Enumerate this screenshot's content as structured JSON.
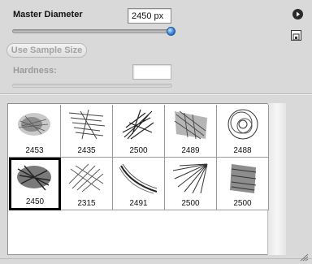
{
  "master_diameter": {
    "label": "Master Diameter",
    "value": "2450 px",
    "slider_fraction": 0.98
  },
  "use_sample_size_label": "Use Sample Size",
  "hardness": {
    "label": "Hardness:",
    "value": ""
  },
  "icons": {
    "flyout": "flyout-menu-icon",
    "new_preset": "new-preset-icon",
    "resize": "resize-grip-icon"
  },
  "brushes": [
    {
      "size": "2453",
      "selected": false
    },
    {
      "size": "2435",
      "selected": false
    },
    {
      "size": "2500",
      "selected": false
    },
    {
      "size": "2489",
      "selected": false
    },
    {
      "size": "2488",
      "selected": false
    },
    {
      "size": "2450",
      "selected": true
    },
    {
      "size": "2315",
      "selected": false
    },
    {
      "size": "2491",
      "selected": false
    },
    {
      "size": "2500",
      "selected": false
    },
    {
      "size": "2500",
      "selected": false
    }
  ]
}
